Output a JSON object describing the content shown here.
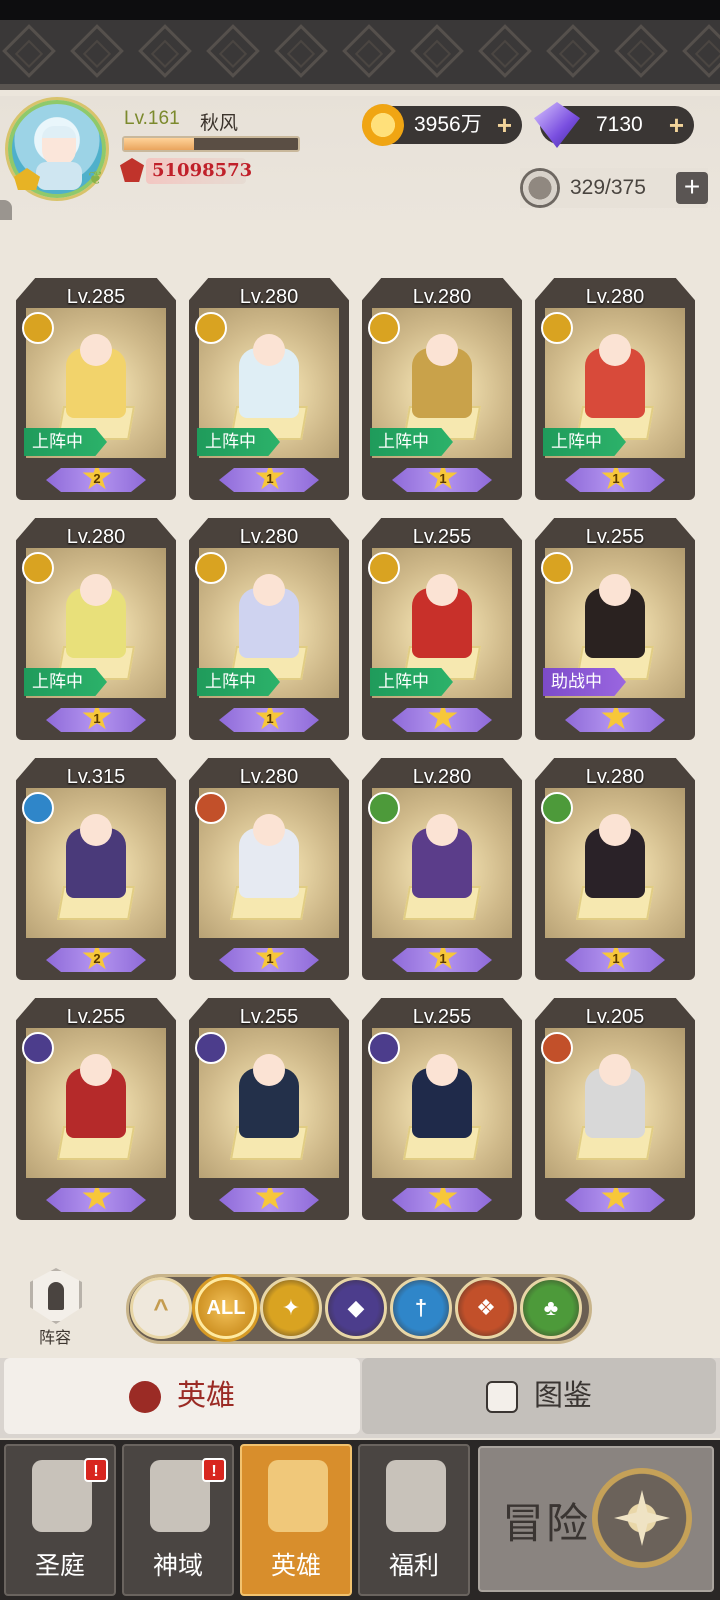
{
  "player": {
    "level": "Lv.161",
    "name": "秋风",
    "power": "51098573",
    "xp_fraction": 0.4
  },
  "currencies": {
    "gold": "3956万",
    "gems": "7130",
    "stamina": "329/375"
  },
  "heroes": [
    {
      "level": "Lv.285",
      "faction": "light",
      "status": "上阵中",
      "stars": "2",
      "color": "#f2d36b"
    },
    {
      "level": "Lv.280",
      "faction": "light",
      "status": "上阵中",
      "stars": "1",
      "color": "#dfeef5"
    },
    {
      "level": "Lv.280",
      "faction": "light",
      "status": "上阵中",
      "stars": "1",
      "color": "#c9a24a"
    },
    {
      "level": "Lv.280",
      "faction": "light",
      "status": "上阵中",
      "stars": "1",
      "color": "#d84a3a"
    },
    {
      "level": "Lv.280",
      "faction": "light",
      "status": "上阵中",
      "stars": "1",
      "color": "#e8e07a"
    },
    {
      "level": "Lv.280",
      "faction": "light",
      "status": "上阵中",
      "stars": "1",
      "color": "#cfd3f0"
    },
    {
      "level": "Lv.255",
      "faction": "light",
      "status": "上阵中",
      "stars": "",
      "color": "#c8302a"
    },
    {
      "level": "Lv.255",
      "faction": "light",
      "status": "助战中",
      "stars": "",
      "color": "#2a2220"
    },
    {
      "level": "Lv.315",
      "faction": "water",
      "status": "",
      "stars": "2",
      "color": "#4a3a7a"
    },
    {
      "level": "Lv.280",
      "faction": "fire",
      "status": "",
      "stars": "1",
      "color": "#e6eaf2"
    },
    {
      "level": "Lv.280",
      "faction": "nature",
      "status": "",
      "stars": "1",
      "color": "#5b3d8a"
    },
    {
      "level": "Lv.280",
      "faction": "nature",
      "status": "",
      "stars": "1",
      "color": "#2a2228"
    },
    {
      "level": "Lv.255",
      "faction": "dark",
      "status": "",
      "stars": "",
      "color": "#b52a2a"
    },
    {
      "level": "Lv.255",
      "faction": "dark",
      "status": "",
      "stars": "",
      "color": "#23304a"
    },
    {
      "level": "Lv.255",
      "faction": "dark",
      "status": "",
      "stars": "",
      "color": "#1f2a4a"
    },
    {
      "level": "Lv.205",
      "faction": "fire",
      "status": "",
      "stars": "",
      "color": "#d8d8d8"
    }
  ],
  "faction_colors": {
    "light": "#d9a321",
    "water": "#2f86c9",
    "fire": "#c2502a",
    "nature": "#4d9a3a",
    "dark": "#4c3d8c"
  },
  "formation_label": "阵容",
  "filters": [
    {
      "icon": "up-arrow-icon",
      "label": "^"
    },
    {
      "icon": "all-filter-icon",
      "label": "ALL"
    },
    {
      "icon": "light-faction-icon",
      "label": "✦",
      "color": "#d9a321"
    },
    {
      "icon": "dark-faction-icon",
      "label": "◆",
      "color": "#4c3d8c"
    },
    {
      "icon": "water-faction-icon",
      "label": "†",
      "color": "#2f86c9"
    },
    {
      "icon": "fire-faction-icon",
      "label": "❖",
      "color": "#c2502a"
    },
    {
      "icon": "nature-faction-icon",
      "label": "♣",
      "color": "#4d9a3a"
    }
  ],
  "tabs": {
    "hero": "英雄",
    "codex": "图鉴"
  },
  "nav": [
    {
      "label": "圣庭",
      "alert": "!",
      "icon": "castle-icon",
      "active": false
    },
    {
      "label": "神域",
      "alert": "!",
      "icon": "crystal-icon",
      "active": false
    },
    {
      "label": "英雄",
      "alert": "",
      "icon": "helmet-icon",
      "active": true
    },
    {
      "label": "福利",
      "alert": "",
      "icon": "chest-icon",
      "active": false
    }
  ],
  "adventure_label": "冒险"
}
